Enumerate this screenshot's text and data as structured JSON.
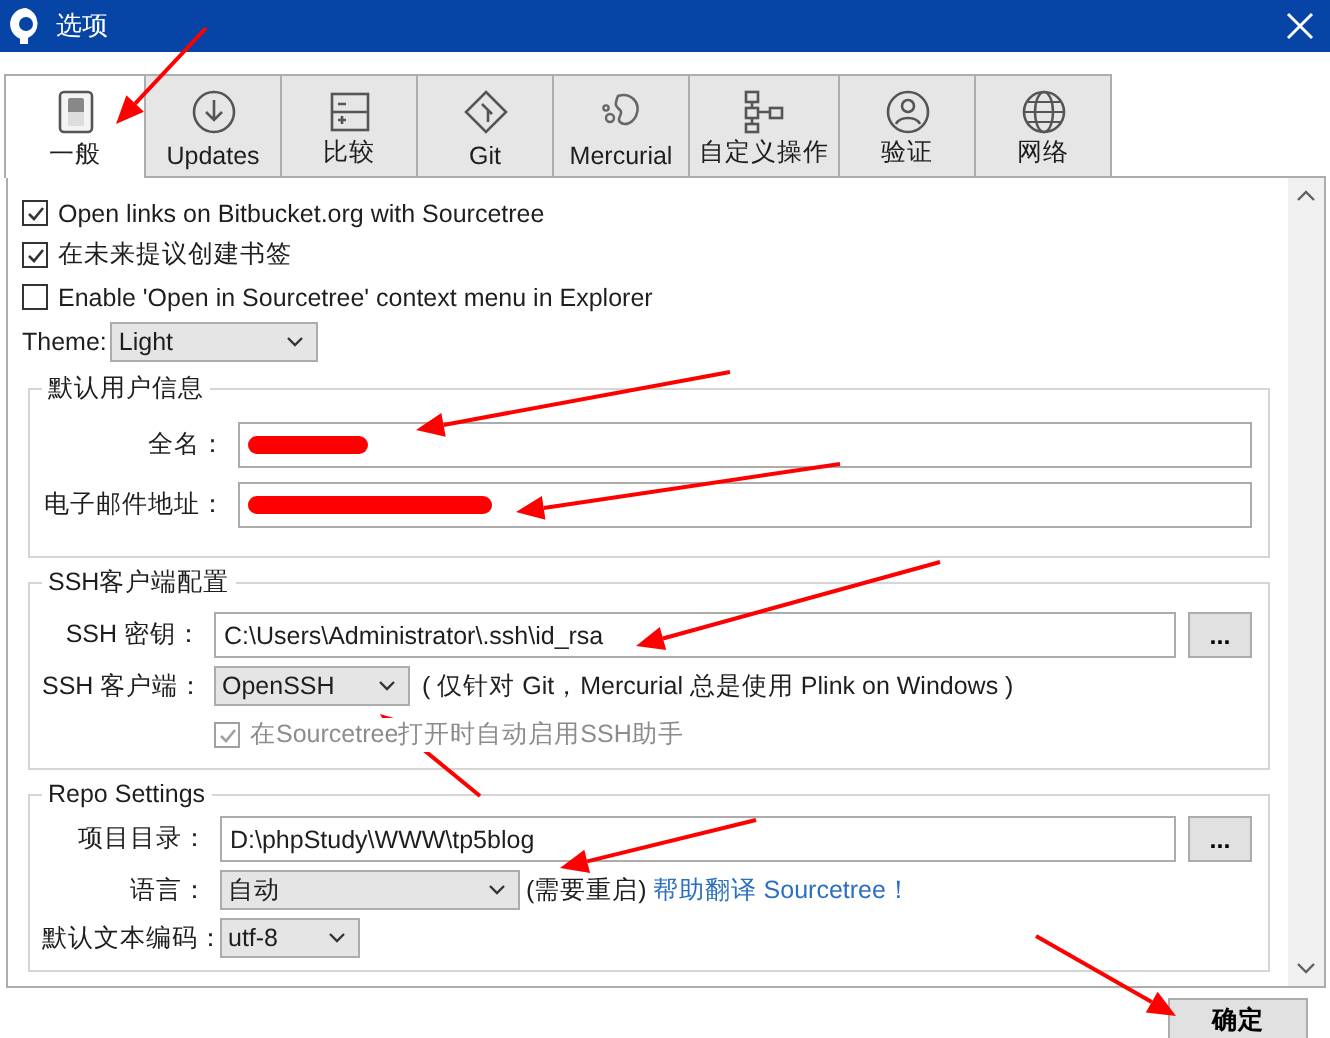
{
  "window": {
    "title": "选项"
  },
  "tabs": [
    {
      "label": "一般",
      "kind": "toggle",
      "selected": true
    },
    {
      "label": "Updates",
      "kind": "download",
      "selected": false
    },
    {
      "label": "比较",
      "kind": "diff",
      "selected": false
    },
    {
      "label": "Git",
      "kind": "git",
      "selected": false
    },
    {
      "label": "Mercurial",
      "kind": "mercurial",
      "selected": false
    },
    {
      "label": "自定义操作",
      "kind": "flow",
      "selected": false
    },
    {
      "label": "验证",
      "kind": "user",
      "selected": false
    },
    {
      "label": "网络",
      "kind": "globe",
      "selected": false
    }
  ],
  "general": {
    "checkboxes": [
      {
        "label": "Open links on Bitbucket.org with Sourcetree",
        "checked": true
      },
      {
        "label": "在未来提议创建书签",
        "checked": true
      },
      {
        "label": "Enable 'Open in Sourcetree' context menu in Explorer",
        "checked": false
      }
    ],
    "theme": {
      "label": "Theme:",
      "value": "Light"
    }
  },
  "user_info": {
    "title": "默认用户信息",
    "fields": [
      {
        "label": "全名：",
        "redacted": true
      },
      {
        "label": "电子邮件地址：",
        "redacted": true
      }
    ]
  },
  "ssh": {
    "title": "SSH客户端配置",
    "key": {
      "label": "SSH 密钥：",
      "value": "C:\\Users\\Administrator\\.ssh\\id_rsa",
      "browse": "..."
    },
    "client": {
      "label": "SSH 客户端：",
      "value": "OpenSSH",
      "note": "( 仅针对 Git，Mercurial 总是使用 Plink on Windows )"
    },
    "auto_agent": {
      "label": "在Sourcetree打开时自动启用SSH助手",
      "checked": true,
      "disabled": true
    }
  },
  "repo": {
    "title": "Repo Settings",
    "project_dir": {
      "label": "项目目录：",
      "value": "D:\\phpStudy\\WWW\\tp5blog",
      "browse": "..."
    },
    "language": {
      "label": "语言：",
      "value": "自动",
      "note": "(需要重启)",
      "link": "帮助翻译 Sourcetree！"
    },
    "encoding": {
      "label": "默认文本编码：",
      "value": "utf-8"
    }
  },
  "buttons": [
    {
      "label": "确定"
    }
  ]
}
